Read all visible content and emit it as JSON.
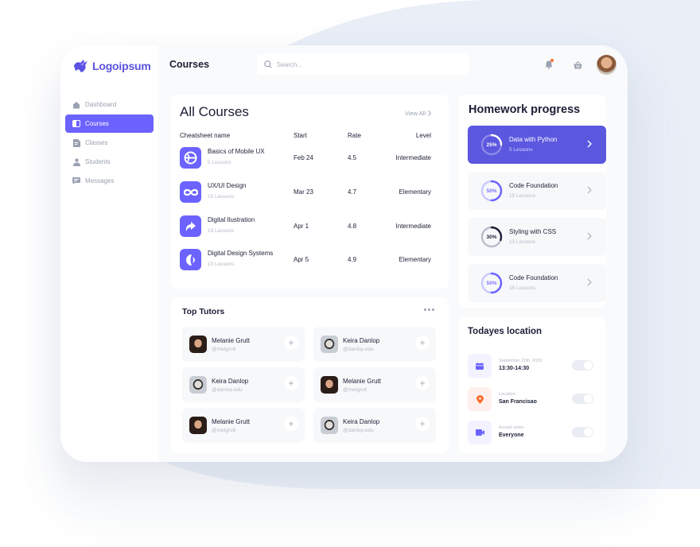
{
  "brand": {
    "name": "Logoipsum",
    "color": "#5a52e0"
  },
  "sidebar": {
    "items": [
      {
        "label": "Dashboard",
        "icon": "home-icon",
        "active": false
      },
      {
        "label": "Courses",
        "icon": "book-icon",
        "active": true
      },
      {
        "label": "Classes",
        "icon": "document-icon",
        "active": false
      },
      {
        "label": "Students",
        "icon": "user-icon",
        "active": false
      },
      {
        "label": "Messages",
        "icon": "message-icon",
        "active": false
      }
    ]
  },
  "header": {
    "title": "Courses",
    "search_placeholder": "Search...",
    "notification_badge": true
  },
  "all_courses": {
    "title": "All Courses",
    "view_all": "View All",
    "columns": [
      "Cheatsheet name",
      "Start",
      "Rate",
      "Level"
    ],
    "rows": [
      {
        "name": "Basics of Mobile UX",
        "lessons": "5 Lessons",
        "start": "Feb 24",
        "rate": "4.5",
        "level": "Intermediate",
        "icon": "globe-icon"
      },
      {
        "name": "UX/UI Design",
        "lessons": "15 Lessons",
        "start": "Mar 23",
        "rate": "4.7",
        "level": "Elementary",
        "icon": "infinity-icon"
      },
      {
        "name": "Digital Ilustration",
        "lessons": "13 Lessons",
        "start": "Apr 1",
        "rate": "4.8",
        "level": "Intermediate",
        "icon": "arrow-curve-icon"
      },
      {
        "name": "Digital Design Systems",
        "lessons": "10 Lessons",
        "start": "Apr 5",
        "rate": "4.9",
        "level": "Elementary",
        "icon": "half-circle-icon"
      }
    ]
  },
  "top_tutors": {
    "title": "Top Tutors",
    "tutors": [
      {
        "name": "Melanie Grutt",
        "handle": "@melgrutt",
        "gender": "female"
      },
      {
        "name": "Keira Danlop",
        "handle": "@danlop.edu",
        "gender": "male"
      },
      {
        "name": "Keira Danlop",
        "handle": "@danlop.edu",
        "gender": "male"
      },
      {
        "name": "Melanie Grutt",
        "handle": "@melgrutt",
        "gender": "female"
      },
      {
        "name": "Melanie Grutt",
        "handle": "@melgrutt",
        "gender": "female"
      },
      {
        "name": "Keira Danlop",
        "handle": "@danlop.edu",
        "gender": "male"
      }
    ]
  },
  "homework": {
    "title": "Homework progress",
    "items": [
      {
        "name": "Data with Python",
        "lessons": "5 Lessons",
        "percent": 25,
        "label": "25%",
        "active": true
      },
      {
        "name": "Code Foundation",
        "lessons": "15 Lessons",
        "percent": 50,
        "label": "50%",
        "active": false
      },
      {
        "name": "Styling with CSS",
        "lessons": "13 Lessons",
        "percent": 30,
        "label": "30%",
        "active": false
      },
      {
        "name": "Code Foundation",
        "lessons": "15 Lessons",
        "percent": 50,
        "label": "50%",
        "active": false
      }
    ]
  },
  "location": {
    "title": "Todayes location",
    "items": [
      {
        "label": "September 20th, 2020",
        "value": "13:30-14:30",
        "icon": "calendar-icon",
        "enabled": false
      },
      {
        "label": "Location",
        "value": "San Francisao",
        "icon": "map-pin-icon",
        "enabled": false
      },
      {
        "label": "Accept video",
        "value": "Everyone",
        "icon": "video-icon",
        "enabled": false
      }
    ]
  },
  "colors": {
    "accent": "#6c63ff",
    "accent_dark": "#5b57df",
    "text": "#1b1f36",
    "muted": "#9aa1b2",
    "notification": "#ff6b2c",
    "location_orange": "#ff6b2c"
  }
}
